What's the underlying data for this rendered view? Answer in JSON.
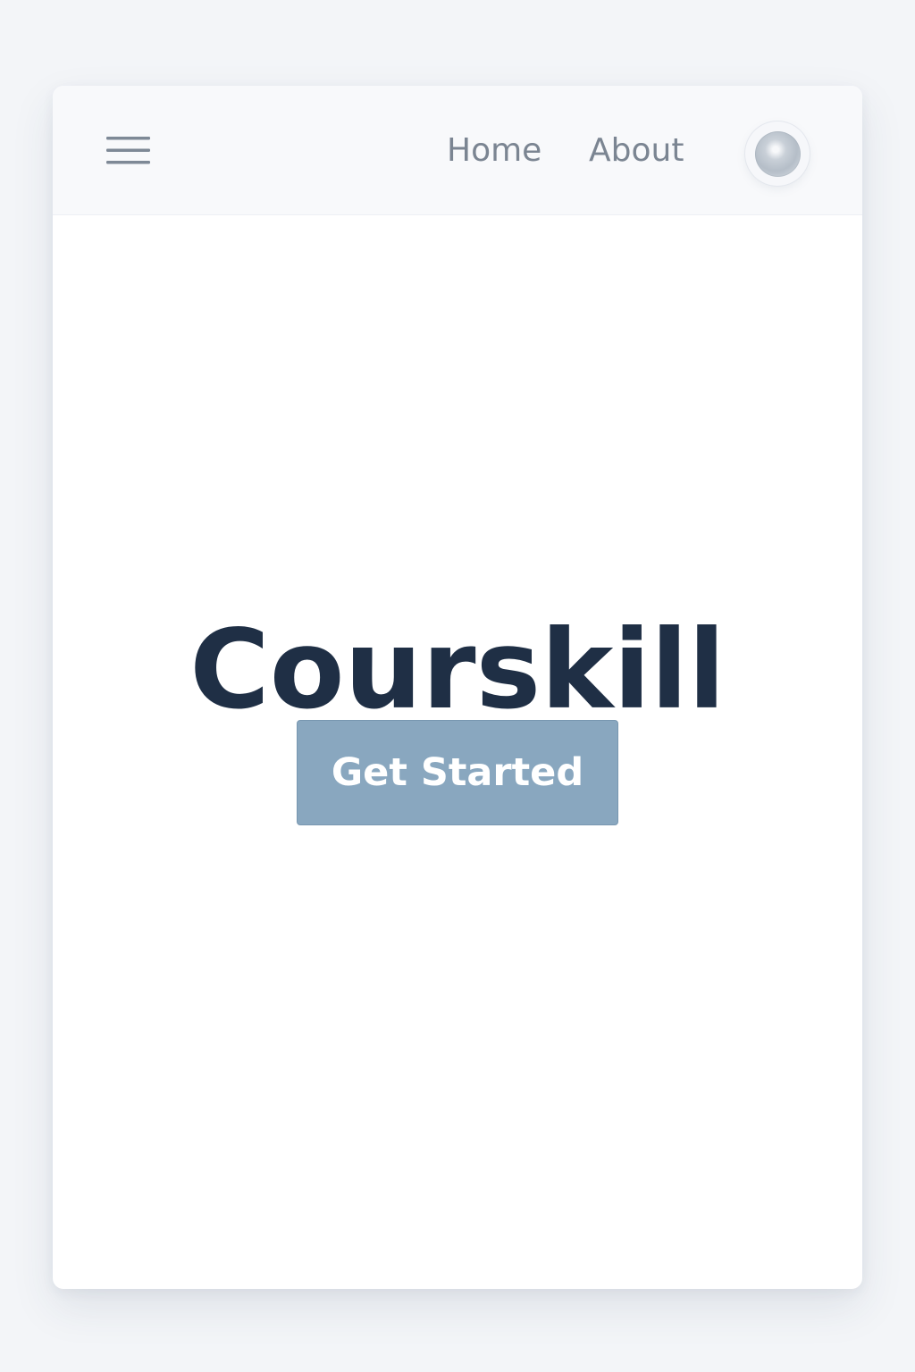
{
  "navigation": {
    "menu_icon": "menu-icon",
    "links": [
      {
        "label": "Home"
      },
      {
        "label": "About"
      }
    ],
    "avatar_icon": "avatar-icon"
  },
  "hero": {
    "title": "Courskill",
    "primary_button_label": "Get Started"
  },
  "colors": {
    "page_background": "#f3f5f8",
    "window_background": "#ffffff",
    "nav_background": "#f8f9fb",
    "nav_text": "#7b8592",
    "title_text": "#1f2f45",
    "button_background": "#89a7bf",
    "button_text": "#ffffff"
  }
}
